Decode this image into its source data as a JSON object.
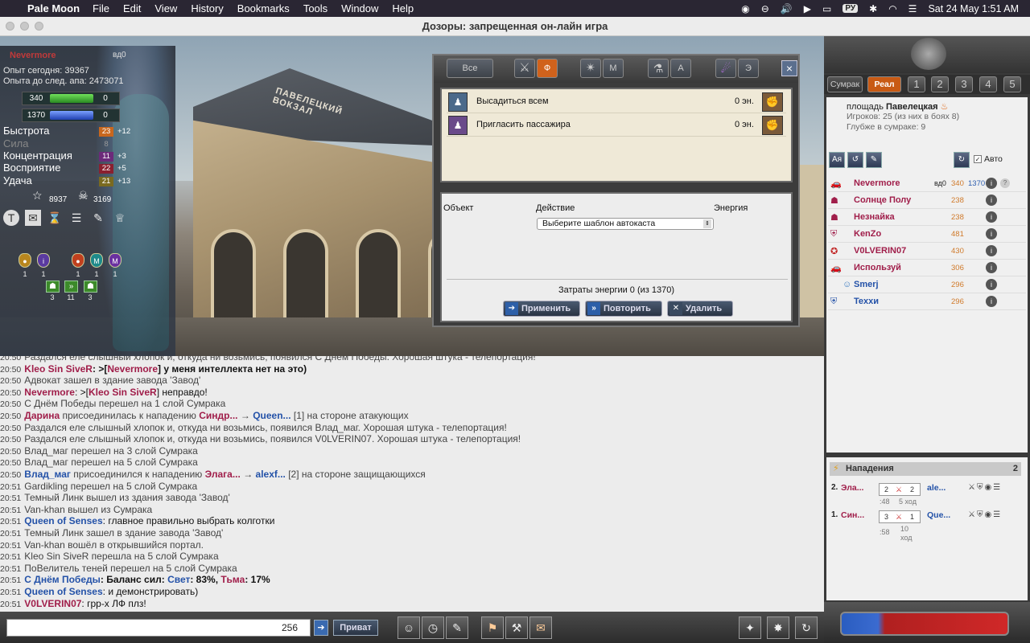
{
  "menubar": {
    "app": "Pale Moon",
    "items": [
      "File",
      "Edit",
      "View",
      "History",
      "Bookmarks",
      "Tools",
      "Window",
      "Help"
    ],
    "input_source": "РУ",
    "datetime": "Sat 24 May  1:51 AM"
  },
  "window": {
    "title": "Дозоры: запрещенная он-лайн игра"
  },
  "scene": {
    "sign": "ПАВЕЛЕЦКИЙ ВОКЗАЛ"
  },
  "character": {
    "name": "Nevermore",
    "level": "вд0",
    "exp_today": "Опыт сегодня: 39367",
    "exp_next": "Опыта до след. апа: 2473071",
    "hp": "340",
    "hp_extra": "0",
    "mana": "1370",
    "mana_extra": "0",
    "stats": [
      {
        "name": "Быстрота",
        "value": "23",
        "bonus": "+12",
        "color": "#c8671e"
      },
      {
        "name": "Сила",
        "value": "8",
        "bonus": "",
        "color": "#555555"
      },
      {
        "name": "Концентрация",
        "value": "11",
        "bonus": "+3",
        "color": "#6c2a7a"
      },
      {
        "name": "Восприятие",
        "value": "22",
        "bonus": "+5",
        "color": "#8a2030"
      },
      {
        "name": "Удача",
        "value": "21",
        "bonus": "+13",
        "color": "#7a6a20"
      }
    ],
    "star_count": "8937",
    "skull_count": "3169",
    "badges": [
      {
        "n": "1",
        "color": "#b8861e"
      },
      {
        "n": "1",
        "color": "#5a3aa0"
      },
      {
        "n": "1",
        "color": "#c0401e"
      },
      {
        "n": "1",
        "color": "#1e8a8a"
      },
      {
        "n": "1",
        "color": "#6a30a0"
      }
    ],
    "green_badges": [
      "3",
      "11",
      "3"
    ]
  },
  "dialog": {
    "tabs": {
      "all": "Все",
      "f": "Ф",
      "m": "М",
      "a": "А",
      "e": "Э"
    },
    "actions": [
      {
        "label": "Высадиться всем",
        "energy": "0 эн."
      },
      {
        "label": "Пригласить пассажира",
        "energy": "0 эн."
      }
    ],
    "headers": {
      "object": "Объект",
      "action": "Действие",
      "energy": "Энергия"
    },
    "select": "Выберите шаблон автокаста",
    "cost": "Затраты энергии 0 (из 1370)",
    "buttons": {
      "apply": "Применить",
      "repeat": "Повторить",
      "delete": "Удалить"
    }
  },
  "right": {
    "layer_twilight": "Сумрак",
    "layer_real": "Реал",
    "layers": [
      "1",
      "2",
      "3",
      "4",
      "5"
    ],
    "location_label": "площадь",
    "location_name": "Павелецкая",
    "players_line": "Игроков: 25 (из них в боях 8)",
    "depth_line": "Глубже в сумраке: 9",
    "auto_label": "Авто",
    "players": [
      {
        "name": "Nevermore",
        "level": "вд0",
        "hp": "340",
        "mp": "1370",
        "color": "#a01e4a",
        "pic": "🚗"
      },
      {
        "name": "Солнце Полу",
        "level": "",
        "hp": "238",
        "mp": "",
        "color": "#a01e4a",
        "pic": "☗"
      },
      {
        "name": "Незнайка",
        "level": "",
        "hp": "238",
        "mp": "",
        "color": "#a01e4a",
        "pic": "☗"
      },
      {
        "name": "KenZo",
        "level": "",
        "hp": "481",
        "mp": "",
        "color": "#a01e4a",
        "pic": "⛨"
      },
      {
        "name": "V0LVERIN07",
        "level": "",
        "hp": "430",
        "mp": "",
        "color": "#a01e4a",
        "pic": "✪"
      },
      {
        "name": "Используй",
        "level": "",
        "hp": "306",
        "mp": "",
        "color": "#a01e4a",
        "pic": "🚗"
      },
      {
        "name": "Smerj",
        "level": "",
        "hp": "296",
        "mp": "",
        "color": "#2452a8",
        "pic": ""
      },
      {
        "name": "Texxи",
        "level": "",
        "hp": "296",
        "mp": "",
        "color": "#2452a8",
        "pic": "⛨"
      }
    ],
    "attacks_title": "Нападения",
    "attacks_count": "2",
    "attacks": [
      {
        "idx": "2.",
        "attacker": "Эла...",
        "a": "2",
        "b": "2",
        "target": "ale...",
        "time": ":48",
        "move": "5 ход"
      },
      {
        "idx": "1.",
        "attacker": "Син...",
        "a": "3",
        "b": "1",
        "target": "Que...",
        "time": ":58",
        "move": "10 ход"
      }
    ]
  },
  "chat": [
    {
      "t": "20:50",
      "segs": [
        {
          "c": "",
          "x": "Раздался еле слышный хлопок и, откуда ни возьмись, появился С Днем Победы. Хорошая штука - телепортация!"
        }
      ]
    },
    {
      "t": "20:50",
      "segs": [
        {
          "c": "nk",
          "x": "Kleo Sin SiveR"
        },
        {
          "c": "bold",
          "x": ": >["
        },
        {
          "c": "nk",
          "x": "Nevermore"
        },
        {
          "c": "bold",
          "x": "]  у меня интеллекта нет на это)"
        }
      ]
    },
    {
      "t": "20:50",
      "segs": [
        {
          "c": "",
          "x": "Адвокат зашел в здание завода 'Завод'"
        }
      ]
    },
    {
      "t": "20:50",
      "segs": [
        {
          "c": "nk",
          "x": "Nevermore"
        },
        {
          "c": "dark",
          "x": ": >["
        },
        {
          "c": "nk",
          "x": "Kleo Sin SiveR"
        },
        {
          "c": "dark",
          "x": "]  неправдо!"
        }
      ]
    },
    {
      "t": "20:50",
      "segs": [
        {
          "c": "",
          "x": "С Днём Победы перешел на 1 слой Сумрака"
        }
      ]
    },
    {
      "t": "20:50",
      "segs": [
        {
          "c": "nk",
          "x": "Дарина"
        },
        {
          "c": "",
          "x": " присоединилась к нападению "
        },
        {
          "c": "nk",
          "x": "Синдр..."
        },
        {
          "c": "",
          "x": " → "
        },
        {
          "c": "nkb",
          "x": "Queen..."
        },
        {
          "c": "",
          "x": " [1] на стороне атакующих"
        }
      ]
    },
    {
      "t": "20:50",
      "segs": [
        {
          "c": "",
          "x": "Раздался еле слышный хлопок и, откуда ни возьмись, появился Влад_маг. Хорошая штука - телепортация!"
        }
      ]
    },
    {
      "t": "20:50",
      "segs": [
        {
          "c": "",
          "x": "Раздался еле слышный хлопок и, откуда ни возьмись, появился V0LVERIN07. Хорошая штука - телепортация!"
        }
      ]
    },
    {
      "t": "20:50",
      "segs": [
        {
          "c": "",
          "x": "Влад_маг перешел на 3 слой Сумрака"
        }
      ]
    },
    {
      "t": "20:50",
      "segs": [
        {
          "c": "",
          "x": "Влад_маг перешел на 5 слой Сумрака"
        }
      ]
    },
    {
      "t": "20:50",
      "segs": [
        {
          "c": "nkb",
          "x": "Влад_маг"
        },
        {
          "c": "",
          "x": " присоединился к нападению "
        },
        {
          "c": "nk",
          "x": "Элага..."
        },
        {
          "c": "",
          "x": " → "
        },
        {
          "c": "nkb",
          "x": "alexf..."
        },
        {
          "c": "",
          "x": " [2] на стороне защищающихся"
        }
      ]
    },
    {
      "t": "20:51",
      "segs": [
        {
          "c": "",
          "x": "Gardikling перешел на 5 слой Сумрака"
        }
      ]
    },
    {
      "t": "20:51",
      "segs": [
        {
          "c": "",
          "x": "Темный Линк вышел из здания завода 'Завод'"
        }
      ]
    },
    {
      "t": "20:51",
      "segs": [
        {
          "c": "",
          "x": "Van-khan вышел из Сумрака"
        }
      ]
    },
    {
      "t": "20:51",
      "segs": [
        {
          "c": "nkb",
          "x": "Queen of Senses"
        },
        {
          "c": "dark",
          "x": ":  главное правильно выбрать колготки"
        }
      ]
    },
    {
      "t": "20:51",
      "segs": [
        {
          "c": "",
          "x": "Темный Линк зашел в здание завода 'Завод'"
        }
      ]
    },
    {
      "t": "20:51",
      "segs": [
        {
          "c": "",
          "x": "Van-khan вошёл в открывшийся портал."
        }
      ]
    },
    {
      "t": "20:51",
      "segs": [
        {
          "c": "",
          "x": "Kleo Sin SiveR перешла на 5 слой Сумрака"
        }
      ]
    },
    {
      "t": "20:51",
      "segs": [
        {
          "c": "",
          "x": "ПоВелитель теней перешел на 5 слой Сумрака"
        }
      ]
    },
    {
      "t": "20:51",
      "segs": [
        {
          "c": "nkb",
          "x": "С Днём Победы"
        },
        {
          "c": "bold",
          "x": ":  Баланс сил: "
        },
        {
          "c": "nkb",
          "x": "Свет"
        },
        {
          "c": "bold",
          "x": ": 83%, "
        },
        {
          "c": "nk",
          "x": "Тьма"
        },
        {
          "c": "bold",
          "x": ": 17%"
        }
      ]
    },
    {
      "t": "20:51",
      "segs": [
        {
          "c": "nkb",
          "x": "Queen of Senses"
        },
        {
          "c": "dark",
          "x": ":  и демонстрировать)"
        }
      ]
    },
    {
      "t": "20:51",
      "segs": [
        {
          "c": "nk",
          "x": "V0LVERIN07"
        },
        {
          "c": "dark",
          "x": ":  грр-х ЛФ плз!"
        }
      ]
    }
  ],
  "input": {
    "counter": "256",
    "private_label": "Приват"
  }
}
